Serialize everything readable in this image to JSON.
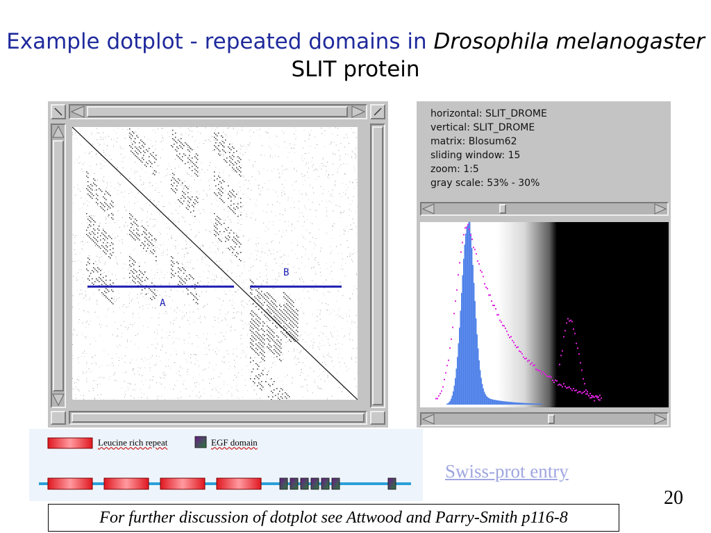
{
  "slide": {
    "title_part1": "Example dotplot - repeated domains in ",
    "title_species": "Drosophila melanogaster",
    "title_part2": " SLIT protein",
    "page_number": "20",
    "footnote": "For further discussion of dotplot see Attwood and Parry-Smith p116-8",
    "swiss_link": "Swiss-prot entry"
  },
  "dotplot": {
    "label_a": "A",
    "label_b": "B"
  },
  "info": {
    "horizontal": "horizontal: SLIT_DROME",
    "vertical": "vertical: SLIT_DROME",
    "matrix": "matrix: Blosum62",
    "window": "sliding window: 15",
    "zoom": "zoom: 1:5",
    "grayscale": "gray scale: 53% - 30%"
  },
  "legend": {
    "lrr_label": "Leucine rich repeat",
    "egf_label": "EGF domain"
  },
  "colors": {
    "title": "#1f2a9c",
    "domain_line": "#1a1ab0",
    "histogram": "#4a7ee8",
    "score_curve": "#e020e0",
    "lrr_box": "#e8202a",
    "egf_box": "#5a2a6a"
  }
}
